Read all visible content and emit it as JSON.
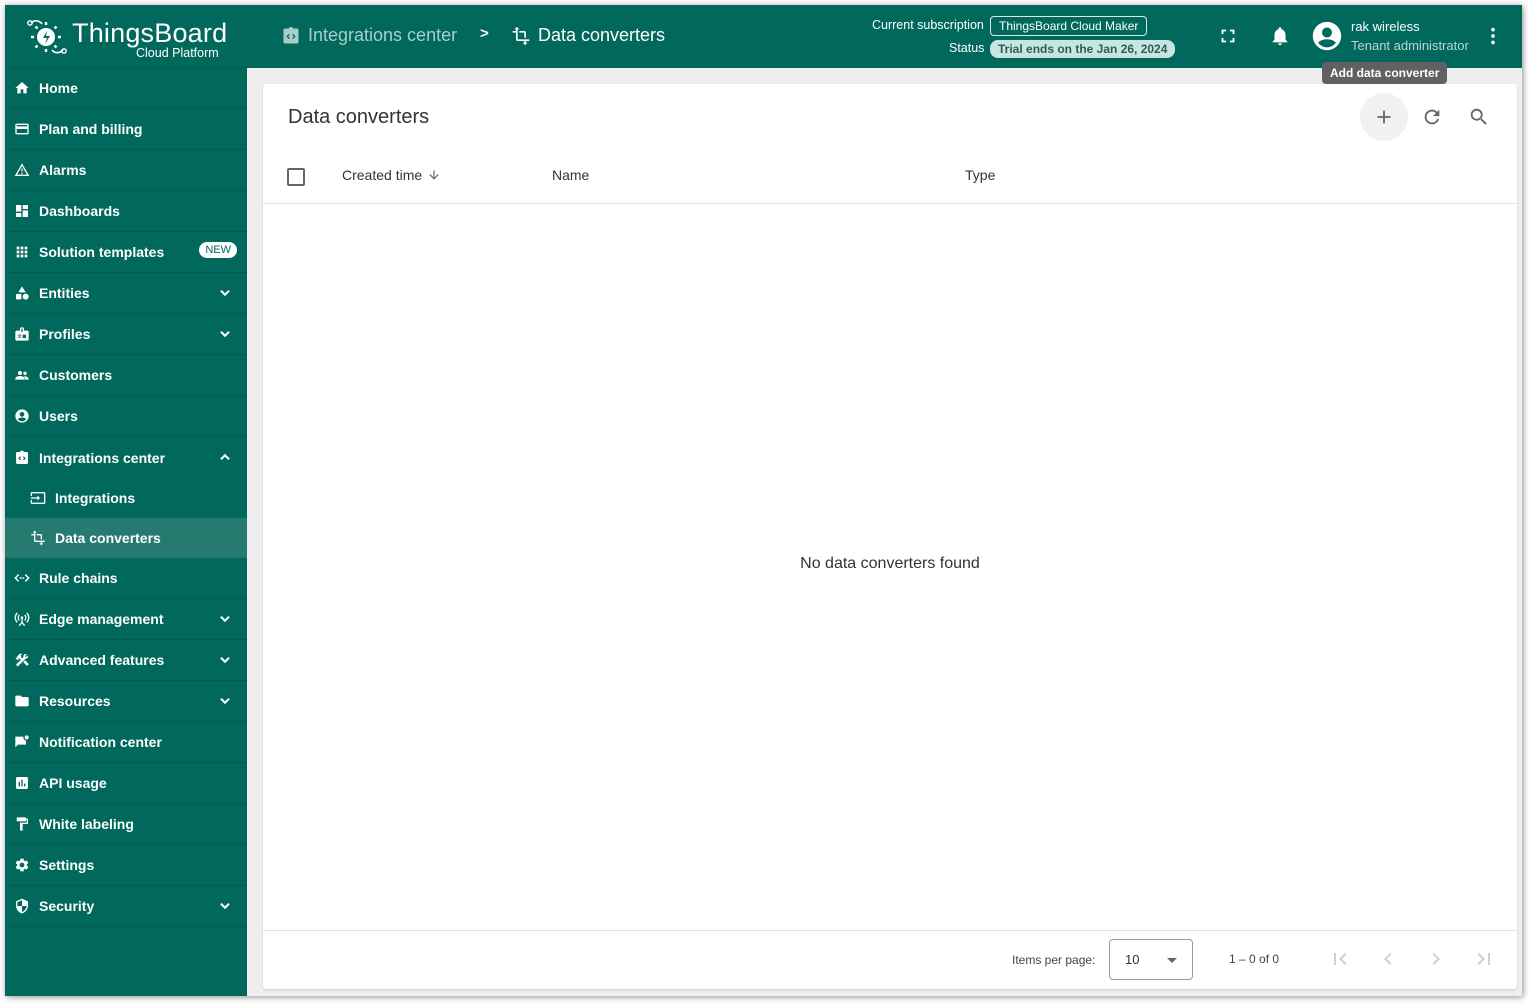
{
  "app": {
    "brand": "ThingsBoard",
    "brand_sub": "Cloud Platform",
    "colors": {
      "primary": "#00695c",
      "active_item": "#267b70",
      "tooltip": "#616161"
    }
  },
  "sidebar": {
    "items": [
      {
        "label": "Home",
        "icon": "home-icon"
      },
      {
        "label": "Plan and billing",
        "icon": "credit-card-icon"
      },
      {
        "label": "Alarms",
        "icon": "warning-icon"
      },
      {
        "label": "Dashboards",
        "icon": "dashboard-icon"
      },
      {
        "label": "Solution templates",
        "icon": "apps-grid-icon",
        "badge": "NEW"
      },
      {
        "label": "Entities",
        "icon": "category-icon",
        "expandable": true
      },
      {
        "label": "Profiles",
        "icon": "badge-icon",
        "expandable": true
      },
      {
        "label": "Customers",
        "icon": "people-icon"
      },
      {
        "label": "Users",
        "icon": "account-circle-icon"
      },
      {
        "label": "Integrations center",
        "icon": "integration-icon",
        "expanded": true,
        "children": [
          {
            "label": "Integrations",
            "icon": "input-icon"
          },
          {
            "label": "Data converters",
            "icon": "transform-icon",
            "active": true
          }
        ]
      },
      {
        "label": "Rule chains",
        "icon": "code-arrows-icon"
      },
      {
        "label": "Edge management",
        "icon": "antenna-icon",
        "expandable": true
      },
      {
        "label": "Advanced features",
        "icon": "tools-icon",
        "expandable": true
      },
      {
        "label": "Resources",
        "icon": "folder-icon",
        "expandable": true
      },
      {
        "label": "Notification center",
        "icon": "notification-chat-icon"
      },
      {
        "label": "API usage",
        "icon": "bar-chart-icon"
      },
      {
        "label": "White labeling",
        "icon": "paint-roller-icon"
      },
      {
        "label": "Settings",
        "icon": "gear-icon"
      },
      {
        "label": "Security",
        "icon": "shield-icon",
        "expandable": true
      }
    ]
  },
  "topbar": {
    "breadcrumb": [
      {
        "label": "Integrations center",
        "icon": "integration-icon"
      },
      {
        "label": "Data converters",
        "icon": "transform-icon"
      }
    ],
    "breadcrumb_separator": ">",
    "subscription_label": "Current subscription",
    "subscription_value": "ThingsBoard Cloud Maker",
    "status_label": "Status",
    "status_value": "Trial ends on the Jan 26, 2024",
    "user_name": "rak wireless",
    "user_role": "Tenant administrator"
  },
  "tooltip": "Add data converter",
  "main": {
    "title": "Data converters",
    "columns": [
      {
        "label": "Created time",
        "sort": "desc"
      },
      {
        "label": "Name"
      },
      {
        "label": "Type"
      }
    ],
    "rows": [],
    "empty_message": "No data converters found",
    "paginator": {
      "items_per_page_label": "Items per page:",
      "items_per_page": "10",
      "range": "1 – 0 of 0"
    }
  }
}
